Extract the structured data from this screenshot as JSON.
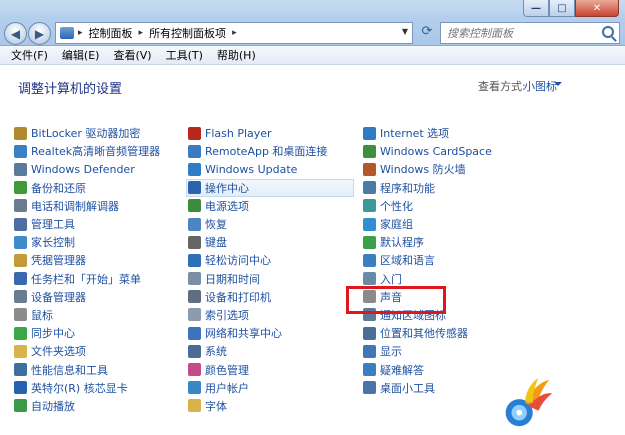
{
  "window": {
    "buttons": {
      "minimize": "—",
      "maximize": "□",
      "close": "✕"
    }
  },
  "address": {
    "crumbs": [
      "控制面板",
      "所有控制面板项"
    ],
    "separator": "▸"
  },
  "search": {
    "placeholder": "搜索控制面板"
  },
  "menu": [
    "文件(F)",
    "编辑(E)",
    "查看(V)",
    "工具(T)",
    "帮助(H)"
  ],
  "page": {
    "title": "调整计算机的设置",
    "viewby_label": "查看方式:",
    "viewby_value": "小图标"
  },
  "columns": [
    [
      {
        "label": "BitLocker 驱动器加密",
        "icon": "bitlocker-icon",
        "color": "#b08a2e"
      },
      {
        "label": "Realtek高清晰音频管理器",
        "icon": "realtek-icon",
        "color": "#3b7fc4"
      },
      {
        "label": "Windows Defender",
        "icon": "defender-icon",
        "color": "#5a7a9a"
      },
      {
        "label": "备份和还原",
        "icon": "backup-icon",
        "color": "#3f9a3c"
      },
      {
        "label": "电话和调制解调器",
        "icon": "phone-icon",
        "color": "#6b7c8e"
      },
      {
        "label": "管理工具",
        "icon": "admin-tools-icon",
        "color": "#4d6fa3"
      },
      {
        "label": "家长控制",
        "icon": "parental-icon",
        "color": "#3f8ac8"
      },
      {
        "label": "凭据管理器",
        "icon": "credential-icon",
        "color": "#c29a3a"
      },
      {
        "label": "任务栏和「开始」菜单",
        "icon": "taskbar-icon",
        "color": "#3a68b0"
      },
      {
        "label": "设备管理器",
        "icon": "device-manager-icon",
        "color": "#6a7d90"
      },
      {
        "label": "鼠标",
        "icon": "mouse-icon",
        "color": "#8c8c8c"
      },
      {
        "label": "同步中心",
        "icon": "sync-icon",
        "color": "#39a846"
      },
      {
        "label": "文件夹选项",
        "icon": "folder-options-icon",
        "color": "#d8b24a"
      },
      {
        "label": "性能信息和工具",
        "icon": "performance-icon",
        "color": "#3f6f9e"
      },
      {
        "label": "英特尔(R) 核芯显卡",
        "icon": "intel-icon",
        "color": "#2563b0"
      },
      {
        "label": "自动播放",
        "icon": "autoplay-icon",
        "color": "#3a9a4a"
      }
    ],
    [
      {
        "label": "Flash Player",
        "icon": "flash-icon",
        "color": "#b8271d"
      },
      {
        "label": "RemoteApp 和桌面连接",
        "icon": "remoteapp-icon",
        "color": "#3a7bc2"
      },
      {
        "label": "Windows Update",
        "icon": "update-icon",
        "color": "#2f7dc9"
      },
      {
        "label": "操作中心",
        "icon": "action-center-icon",
        "color": "#2d62b0"
      },
      {
        "label": "电源选项",
        "icon": "power-icon",
        "color": "#3d8b3d"
      },
      {
        "label": "恢复",
        "icon": "recovery-icon",
        "color": "#4c86c2"
      },
      {
        "label": "键盘",
        "icon": "keyboard-icon",
        "color": "#666666"
      },
      {
        "label": "轻松访问中心",
        "icon": "ease-access-icon",
        "color": "#2f6fb8"
      },
      {
        "label": "日期和时间",
        "icon": "datetime-icon",
        "color": "#7a8ea6"
      },
      {
        "label": "设备和打印机",
        "icon": "printer-icon",
        "color": "#5f6f80"
      },
      {
        "label": "索引选项",
        "icon": "index-icon",
        "color": "#8a9bb0"
      },
      {
        "label": "网络和共享中心",
        "icon": "network-icon",
        "color": "#3b74b8"
      },
      {
        "label": "系统",
        "icon": "system-icon",
        "color": "#4b6d95"
      },
      {
        "label": "颜色管理",
        "icon": "color-mgmt-icon",
        "color": "#c44a8a"
      },
      {
        "label": "用户帐户",
        "icon": "user-accounts-icon",
        "color": "#3a86c6"
      },
      {
        "label": "字体",
        "icon": "fonts-icon",
        "color": "#d8b24a"
      }
    ],
    [
      {
        "label": "Internet 选项",
        "icon": "internet-icon",
        "color": "#2f7bc4"
      },
      {
        "label": "Windows CardSpace",
        "icon": "cardspace-icon",
        "color": "#3e8f3e"
      },
      {
        "label": "Windows 防火墙",
        "icon": "firewall-icon",
        "color": "#b5572a"
      },
      {
        "label": "程序和功能",
        "icon": "programs-icon",
        "color": "#4a7aa8"
      },
      {
        "label": "个性化",
        "icon": "personalize-icon",
        "color": "#3a9a9a"
      },
      {
        "label": "家庭组",
        "icon": "homegroup-icon",
        "color": "#2f8fcf"
      },
      {
        "label": "默认程序",
        "icon": "default-programs-icon",
        "color": "#3aa04a"
      },
      {
        "label": "区域和语言",
        "icon": "region-icon",
        "color": "#3a7fc4"
      },
      {
        "label": "入门",
        "icon": "getting-started-icon",
        "color": "#6a8aa8"
      },
      {
        "label": "声音",
        "icon": "sound-icon",
        "color": "#8a8a8a"
      },
      {
        "label": "通知区域图标",
        "icon": "notification-icon",
        "color": "#5a7a9a"
      },
      {
        "label": "位置和其他传感器",
        "icon": "sensor-icon",
        "color": "#4a6f96"
      },
      {
        "label": "显示",
        "icon": "display-icon",
        "color": "#3f78b8"
      },
      {
        "label": "疑难解答",
        "icon": "troubleshoot-icon",
        "color": "#3a7fc4"
      },
      {
        "label": "桌面小工具",
        "icon": "gadgets-icon",
        "color": "#4a74a8"
      }
    ]
  ],
  "highlight_item": "声音",
  "colors": {
    "link": "#1e50a2",
    "title": "#1e3287",
    "highlight_border": "#e0161d"
  }
}
